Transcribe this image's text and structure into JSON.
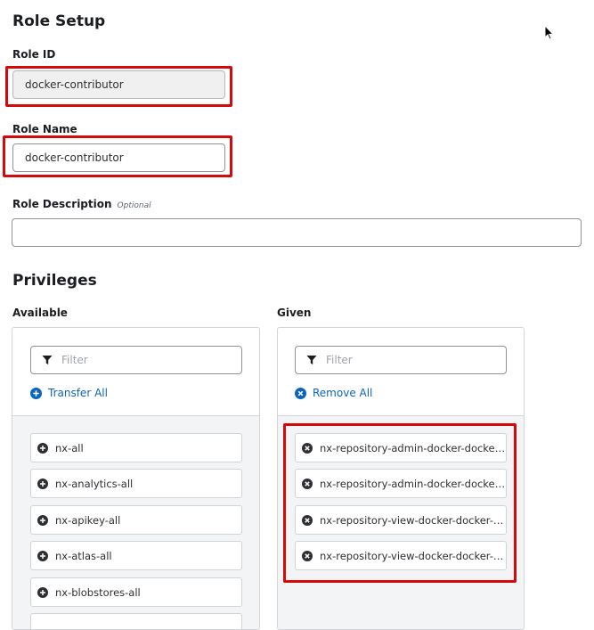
{
  "role_setup": {
    "title": "Role Setup",
    "role_id_label": "Role ID",
    "role_id_value": "docker-contributor",
    "role_name_label": "Role Name",
    "role_name_value": "docker-contributor",
    "role_description_label": "Role Description",
    "optional_tag": "Optional",
    "role_description_value": ""
  },
  "privileges": {
    "title": "Privileges",
    "available": {
      "label": "Available",
      "filter_placeholder": "Filter",
      "action_label": "Transfer All",
      "items": [
        "nx-all",
        "nx-analytics-all",
        "nx-apikey-all",
        "nx-atlas-all",
        "nx-blobstores-all"
      ]
    },
    "given": {
      "label": "Given",
      "filter_placeholder": "Filter",
      "action_label": "Remove All",
      "items": [
        "nx-repository-admin-docker-docker-hosted-*",
        "nx-repository-admin-docker-docker-proxy-*",
        "nx-repository-view-docker-docker-hosted-*",
        "nx-repository-view-docker-docker-proxy-*"
      ]
    }
  },
  "colors": {
    "highlight": "#d20a0a",
    "link": "#0b64c0"
  }
}
